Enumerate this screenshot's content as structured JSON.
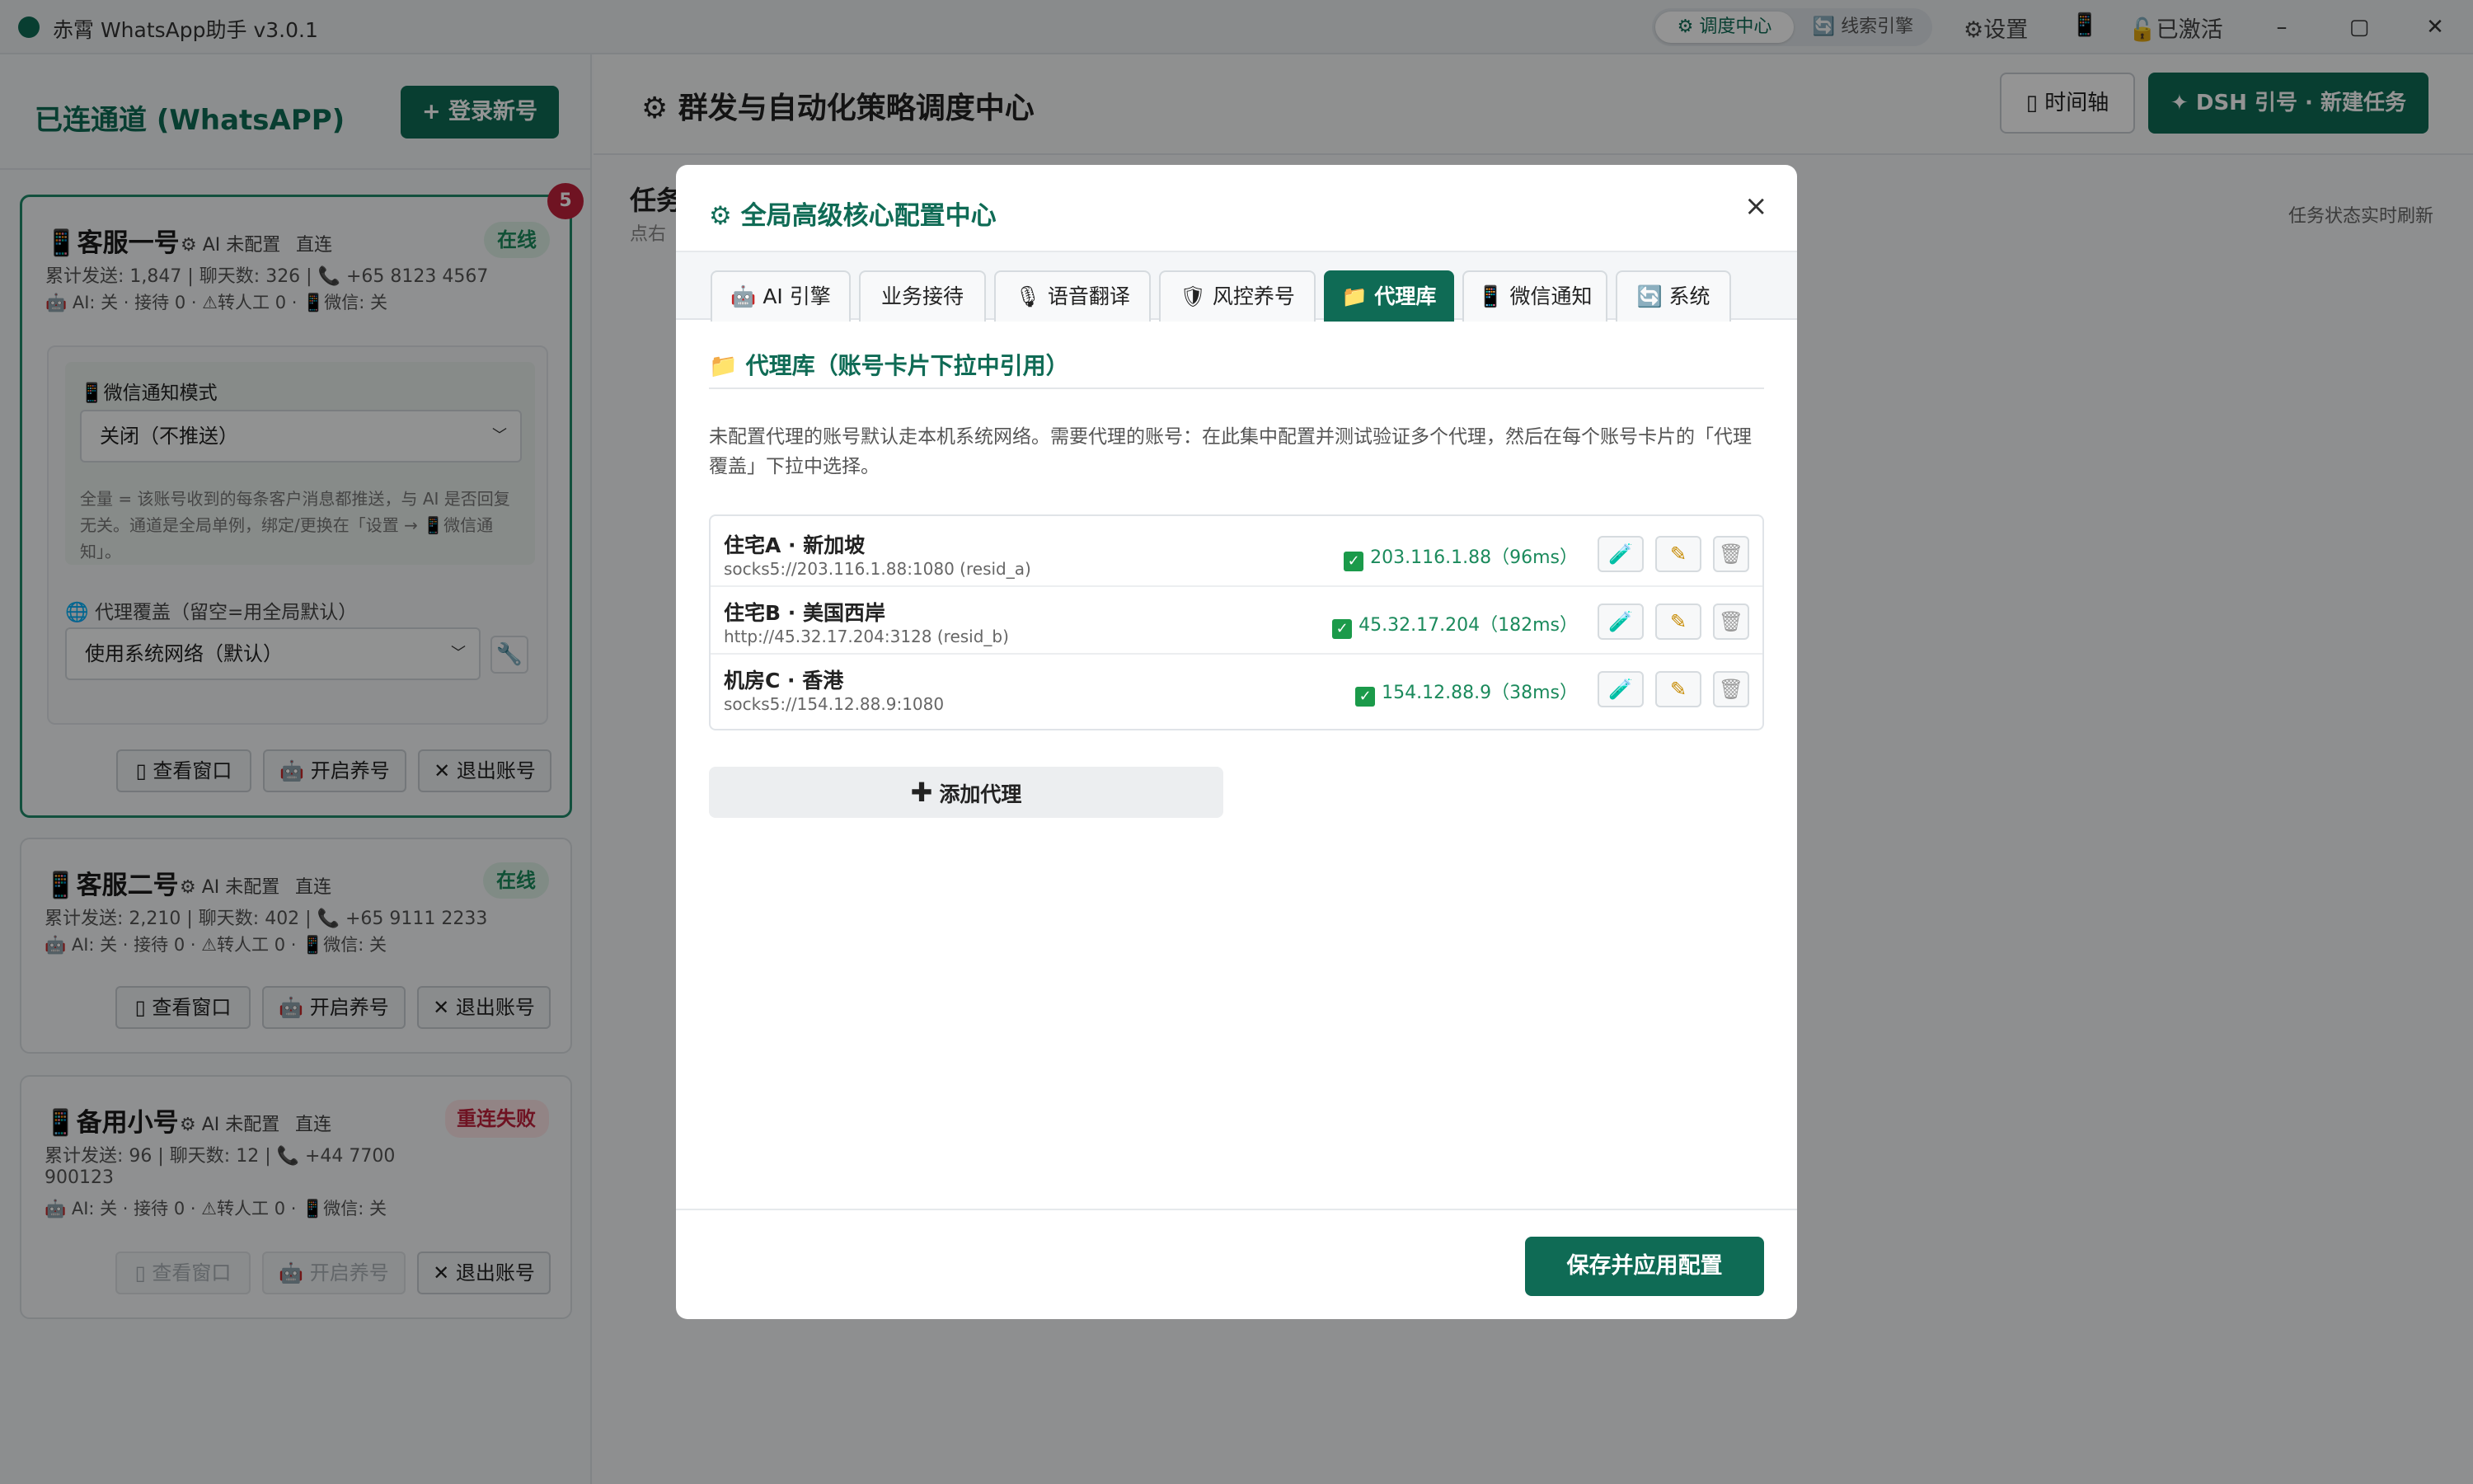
{
  "app": {
    "title": "赤霄 WhatsApp助手 v3.0.1"
  },
  "topbar": {
    "seg_active": "⚙ 调度中心",
    "seg_other": "🔄 线索引擎",
    "settings": "⚙设置",
    "phone_icon": "📱",
    "activated": "🔓已激活",
    "min": "–",
    "max": "▢",
    "close": "✕"
  },
  "sidebar": {
    "title": "已连通道 (WhatsAPP)",
    "login_button": "+ 登录新号",
    "notification_count": "5",
    "accounts": [
      {
        "name": "客服一号",
        "ai_config": "⚙ AI 未配置",
        "conn": "直连",
        "status": "在线",
        "stats": "累计发送: 1,847 | 聊天数: 326 | 📞 +65 8123 4567",
        "sub": "🤖 AI: 关 · 接待 0 · ⚠转人工 0 · 📱微信: 关",
        "wechat_label": "📱微信通知模式",
        "wechat_value": "关闭（不推送）",
        "wechat_hint": "全量 = 该账号收到的每条客户消息都推送，与 AI 是否回复无关。通道是全局单例，绑定/更换在「设置 → 📱微信通知」。",
        "proxy_label": "🌐 代理覆盖（留空=用全局默认）",
        "proxy_value": "使用系统网络（默认）",
        "btn_view": "▯ 查看窗口",
        "btn_nurture": "🤖 开启养号",
        "btn_logout": "✕ 退出账号"
      },
      {
        "name": "客服二号",
        "ai_config": "⚙ AI 未配置",
        "conn": "直连",
        "status": "在线",
        "stats": "累计发送: 2,210 | 聊天数: 402 | 📞 +65 9111 2233",
        "sub": "🤖 AI: 关 · 接待 0 · ⚠转人工 0 · 📱微信: 关",
        "btn_view": "▯ 查看窗口",
        "btn_nurture": "🤖 开启养号",
        "btn_logout": "✕ 退出账号"
      },
      {
        "name": "备用小号",
        "ai_config": "⚙ AI 未配置",
        "conn": "直连",
        "status": "重连失败",
        "stats_1": "累计发送: 96 | 聊天数: 12 | 📞 +44 7700",
        "stats_2": "900123",
        "sub": "🤖 AI: 关 · 接待 0 · ⚠转人工 0 · 📱微信: 关",
        "btn_view": "▯ 查看窗口",
        "btn_nurture": "🤖 开启养号",
        "btn_logout": "✕ 退出账号"
      }
    ]
  },
  "header": {
    "title": "⚙ 群发与自动化策略调度中心",
    "timeline_button": "▯ 时间轴",
    "new_task_button": "✦ DSH 引号 · 新建任务"
  },
  "tasks": {
    "label": "任务",
    "sub": "点右",
    "realtime": "任务状态实时刷新"
  },
  "modal": {
    "title": "⚙ 全局高级核心配置中心",
    "close": "×",
    "tabs": [
      "🤖 AI 引擎",
      "业务接待",
      "🎙 语音翻译",
      "🛡 风控养号",
      "📁 代理库",
      "📱 微信通知",
      "🔄 系统"
    ],
    "section_title": "📁 代理库（账号卡片下拉中引用）",
    "description": "未配置代理的账号默认走本机系统网络。需要代理的账号：在此集中配置并测试验证多个代理，然后在每个账号卡片的「代理覆盖」下拉中选择。",
    "proxies": [
      {
        "name": "住宅A · 新加坡",
        "url": "socks5://203.116.1.88:1080 (resid_a)",
        "status": "203.116.1.88（96ms）"
      },
      {
        "name": "住宅B · 美国西岸",
        "url": "http://45.32.17.204:3128 (resid_b)",
        "status": "45.32.17.204（182ms）"
      },
      {
        "name": "机房C · 香港",
        "url": "socks5://154.12.88.9:1080",
        "status": "154.12.88.9（38ms）"
      }
    ],
    "add_button": "添加代理",
    "save_button": "保存并应用配置"
  },
  "colors": {
    "accent": "#0f6b55",
    "online": "#1b8a5c",
    "error": "#c0223c"
  }
}
